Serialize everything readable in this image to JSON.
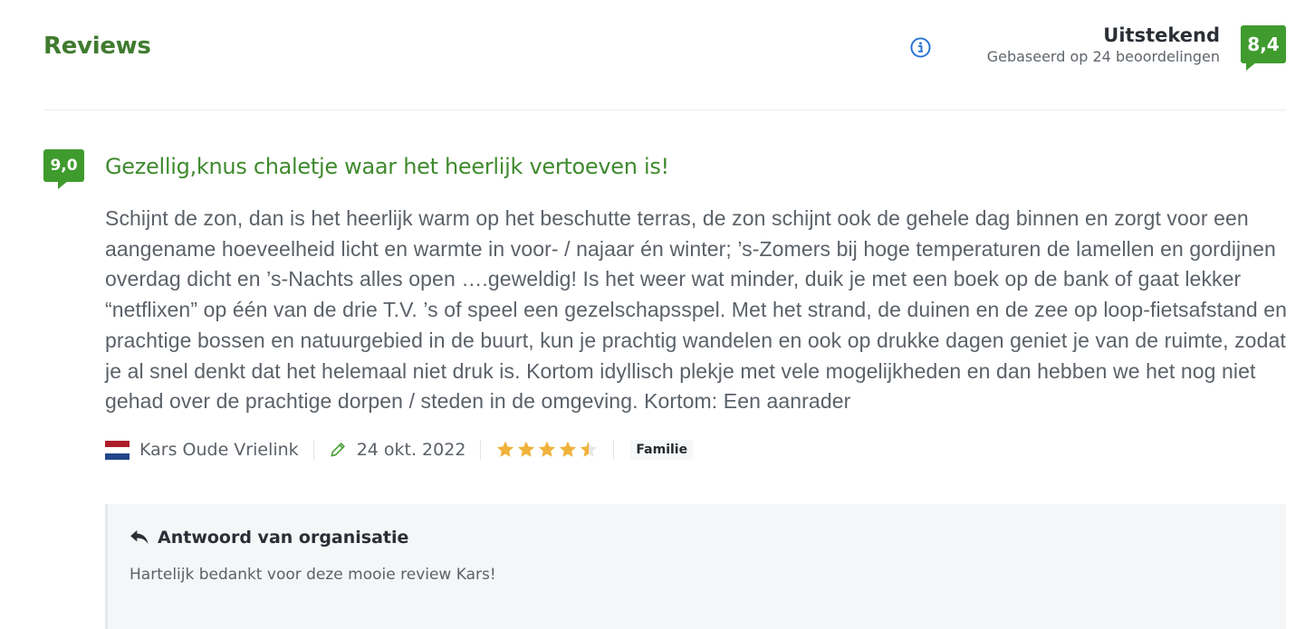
{
  "header": {
    "title": "Reviews",
    "rating_label": "Uitstekend",
    "rating_subtext": "Gebaseerd op 24 beoordelingen",
    "overall_score": "8,4",
    "info_icon": "info-icon"
  },
  "review": {
    "score": "9,0",
    "title": "Gezellig,knus chaletje waar het heerlijk vertoeven is!",
    "body": "Schijnt de zon, dan is het heerlijk warm op het beschutte terras, de zon schijnt ook de gehele dag binnen en zorgt voor een aangename hoeveelheid licht en warmte in voor- / najaar én winter; ’s-Zomers bij hoge temperaturen de lamellen en gordijnen overdag dicht en ’s-Nachts alles open ….geweldig! Is het weer wat minder, duik je met een boek op de bank of gaat lekker “netflixen” op één van de drie T.V. ’s of speel een gezelschapsspel. Met het strand, de duinen en de zee op loop-fietsafstand en prachtige bossen en natuurgebied in de buurt, kun je prachtig wandelen en ook op drukke dagen geniet je van de ruimte, zodat je al snel denkt dat het helemaal niet druk is. Kortom idyllisch plekje met vele mogelijkheden en dan hebben we het nog niet gehad over de prachtige dorpen / steden in de omgeving. Kortom: Een aanrader",
    "author": "Kars Oude Vrielink",
    "author_flag": "netherlands-flag-icon",
    "date": "24 okt. 2022",
    "stars_value": 4.5,
    "stars_max": 5,
    "tag": "Familie"
  },
  "reply": {
    "heading": "Antwoord van organisatie",
    "text": "Hartelijk bedankt voor deze mooie review Kars!",
    "icon": "reply-arrow-icon"
  },
  "colors": {
    "brand_green": "#3f9b2e",
    "title_green": "#3f8a2e",
    "info_blue": "#1f6fd6",
    "star_gold": "#f0b23a"
  }
}
